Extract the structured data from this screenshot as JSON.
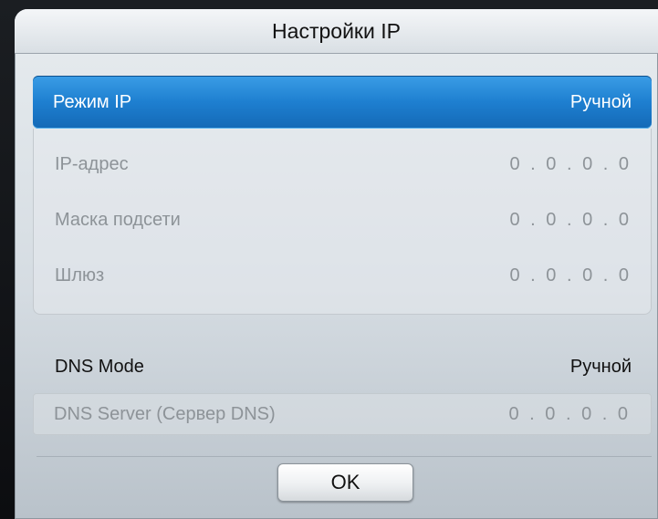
{
  "dialog": {
    "title": "Настройки IP"
  },
  "ip_mode": {
    "label": "Режим IP",
    "value": "Ручной"
  },
  "ip_fields": [
    {
      "label": "IP-адрес",
      "value": "0 . 0 . 0 . 0"
    },
    {
      "label": "Маска подсети",
      "value": "0 . 0 . 0 . 0"
    },
    {
      "label": "Шлюз",
      "value": "0 . 0 . 0 . 0"
    }
  ],
  "dns_mode": {
    "label": "DNS Mode",
    "value": "Ручной"
  },
  "dns_server": {
    "label": "DNS Server (Сервер DNS)",
    "value": "0 . 0 . 0 . 0"
  },
  "buttons": {
    "ok_label": "OK"
  },
  "colors": {
    "accent": "#1e7fd0",
    "disabled_text": "#8d9398"
  }
}
